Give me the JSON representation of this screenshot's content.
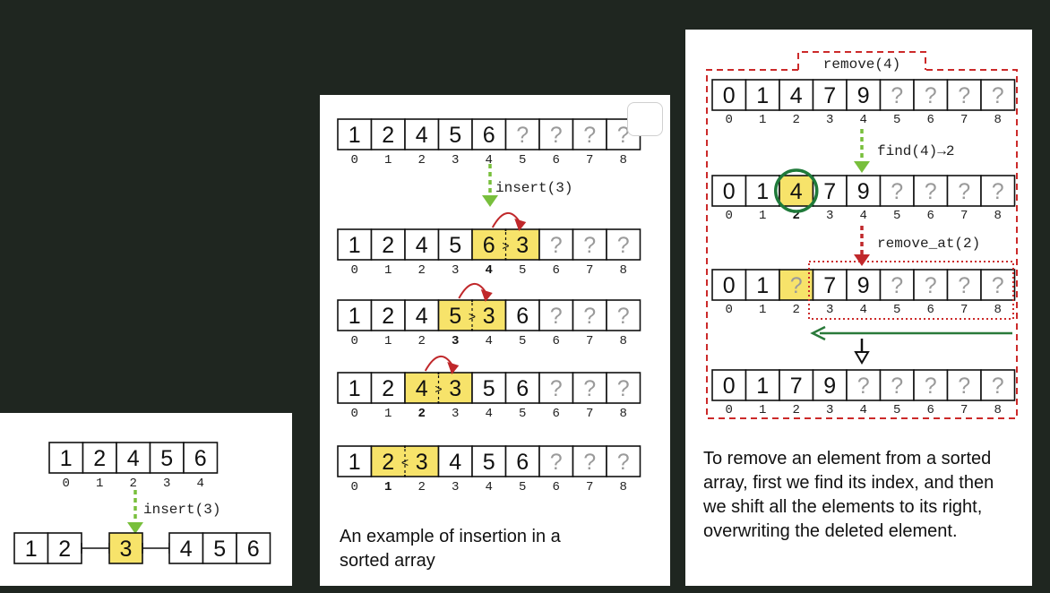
{
  "panel_a": {
    "top_array": [
      "1",
      "2",
      "4",
      "5",
      "6"
    ],
    "top_indices": [
      "0",
      "1",
      "2",
      "3",
      "4"
    ],
    "op_label": "insert(3)",
    "bottom_left": [
      "1",
      "2"
    ],
    "bottom_mid": "3",
    "bottom_right": [
      "4",
      "5",
      "6"
    ]
  },
  "panel_b": {
    "op_label": "insert(3)",
    "indices": [
      "0",
      "1",
      "2",
      "3",
      "4",
      "5",
      "6",
      "7",
      "8"
    ],
    "rows": [
      {
        "cells": [
          "1",
          "2",
          "4",
          "5",
          "6",
          "?",
          "?",
          "?",
          "?"
        ],
        "bold_index": null,
        "compare": null
      },
      {
        "cells": [
          "1",
          "2",
          "4",
          "5",
          "6",
          "3",
          "?",
          "?",
          "?"
        ],
        "bold_index": 4,
        "compare": ">"
      },
      {
        "cells": [
          "1",
          "2",
          "4",
          "5",
          "3",
          "6",
          "?",
          "?",
          "?"
        ],
        "bold_index": 3,
        "compare": ">"
      },
      {
        "cells": [
          "1",
          "2",
          "4",
          "3",
          "5",
          "6",
          "?",
          "?",
          "?"
        ],
        "bold_index": 2,
        "compare": ">"
      },
      {
        "cells": [
          "1",
          "2",
          "3",
          "4",
          "5",
          "6",
          "?",
          "?",
          "?"
        ],
        "bold_index": 1,
        "compare": "<"
      }
    ],
    "caption": "An example of insertion in a sorted array",
    "colors": {
      "highlight": "#f7e36a",
      "new_value": "#d42a25",
      "final_value": "#2e8b2e",
      "arrow_green": "#78bf3c",
      "arrow_red": "#c0282b"
    }
  },
  "panel_c": {
    "title": "remove(4)",
    "find_label": "find(4)→2",
    "remove_at_label": "remove_at(2)",
    "indices": [
      "0",
      "1",
      "2",
      "3",
      "4",
      "5",
      "6",
      "7",
      "8"
    ],
    "rows": [
      {
        "cells": [
          "0",
          "1",
          "4",
          "7",
          "9",
          "?",
          "?",
          "?",
          "?"
        ]
      },
      {
        "cells": [
          "0",
          "1",
          "4",
          "7",
          "9",
          "?",
          "?",
          "?",
          "?"
        ]
      },
      {
        "cells": [
          "0",
          "1",
          "?",
          "7",
          "9",
          "?",
          "?",
          "?",
          "?"
        ]
      },
      {
        "cells": [
          "0",
          "1",
          "7",
          "9",
          "?",
          "?",
          "?",
          "?",
          "?"
        ]
      }
    ],
    "caption": "To remove an element from a sorted array, first we find its index, and then we shift all the elements to its right, overwriting the deleted element.",
    "colors": {
      "dashed_border": "#cc2a2a",
      "circle": "#1f7a3a",
      "shift_arrow": "#2a7a3a"
    }
  }
}
